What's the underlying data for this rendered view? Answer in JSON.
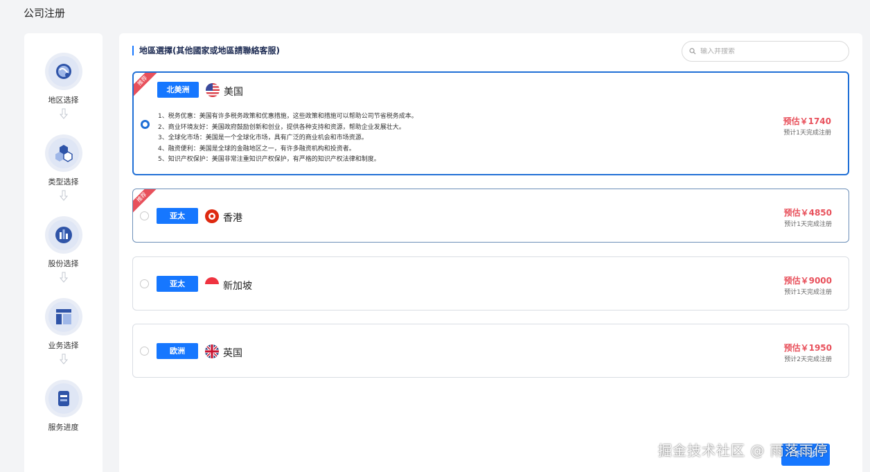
{
  "page_title": "公司注册",
  "steps": [
    {
      "label": "地区选择",
      "icon": "globe-icon"
    },
    {
      "label": "类型选择",
      "icon": "hexagons-icon"
    },
    {
      "label": "股份选择",
      "icon": "bar-chart-icon"
    },
    {
      "label": "业务选择",
      "icon": "layout-icon"
    },
    {
      "label": "服务进度",
      "icon": "document-icon"
    }
  ],
  "region_section": {
    "title": "地區選擇(其他國家或地區請聯絡客服)",
    "search_placeholder": "输入并搜索"
  },
  "regions": [
    {
      "ribbon": "推荐",
      "area": "北美洲",
      "country": "美国",
      "flag": "us-flag",
      "selected": true,
      "benefits": [
        "1、税务优惠：美国有许多税务政策和优惠措施，这些政策和措施可以帮助公司节省税务成本。",
        "2、商业环境友好：美国政府鼓励创新和创业，提供各种支持和资源，帮助企业发展壮大。",
        "3、全球化市场：美国是一个全球化市场，具有广泛的商业机会和市场资源。",
        "4、融资便利：美国是全球的金融地区之一，有许多融资机构和投资者。",
        "5、知识产权保护：美国非常注重知识产权保护，有严格的知识产权法律和制度。"
      ],
      "price": "预估￥1740",
      "eta": "预计1天完成注册"
    },
    {
      "ribbon": "推荐",
      "area": "亚太",
      "country": "香港",
      "flag": "hk-flag",
      "selected": false,
      "price": "预估￥4850",
      "eta": "预计1天完成注册"
    },
    {
      "area": "亚太",
      "country": "新加坡",
      "flag": "sg-flag",
      "selected": false,
      "price": "预估￥9000",
      "eta": "预计1天完成注册"
    },
    {
      "area": "欧洲",
      "country": "英国",
      "flag": "uk-flag",
      "selected": false,
      "price": "预估￥1950",
      "eta": "预计2天完成注册"
    }
  ],
  "next_button": "下一步",
  "watermark": "掘金技术社区 @ 雨落雨停",
  "colors": {
    "primary": "#1677ff",
    "price_red": "#e8505b",
    "selected_border": "#1f6fd6"
  }
}
